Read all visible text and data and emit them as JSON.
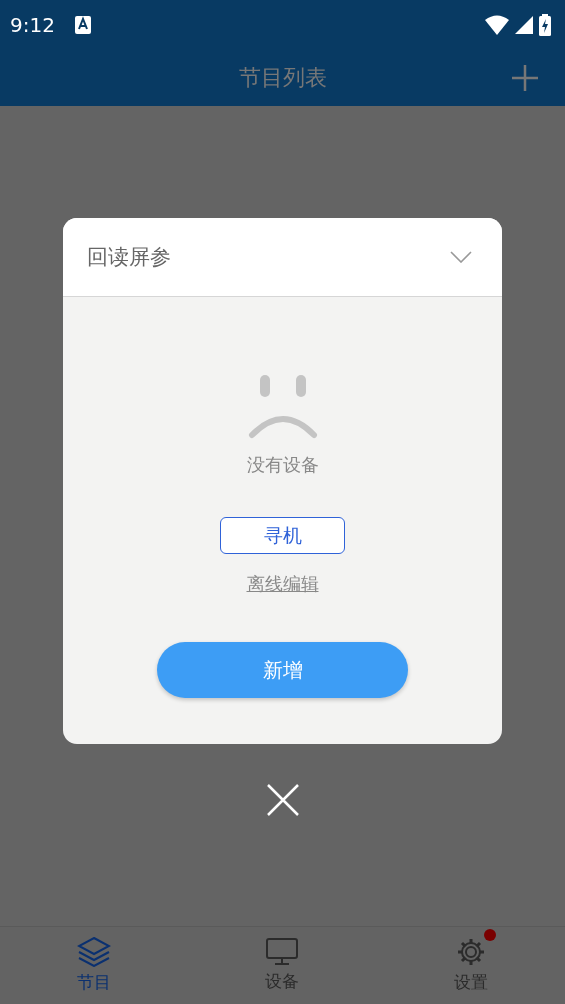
{
  "status_bar": {
    "time": "9:12"
  },
  "app_bar": {
    "title": "节目列表"
  },
  "dialog": {
    "title": "回读屏参",
    "expanded": false,
    "empty_message": "没有设备",
    "search_button": "寻机",
    "offline_link": "离线编辑",
    "add_button": "新增"
  },
  "bottom_nav": [
    {
      "label": "节目",
      "kind": "layers",
      "selected": true,
      "badge": false
    },
    {
      "label": "设备",
      "kind": "monitor",
      "selected": false,
      "badge": false
    },
    {
      "label": "设置",
      "kind": "gear",
      "selected": false,
      "badge": true
    }
  ]
}
